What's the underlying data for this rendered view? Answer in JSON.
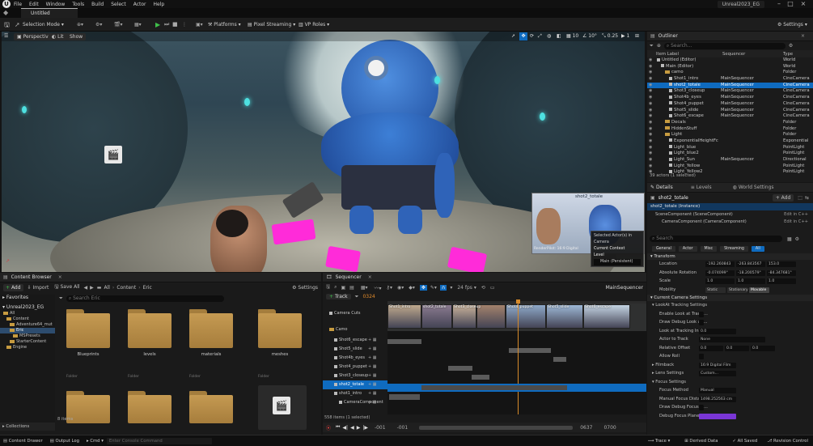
{
  "menubar": {
    "items": [
      "File",
      "Edit",
      "Window",
      "Tools",
      "Build",
      "Select",
      "Actor",
      "Help"
    ],
    "project": "Unreal2023_EG"
  },
  "tab": {
    "title": "Untitled"
  },
  "toolbar": {
    "mode": "Selection Mode",
    "platforms": "Platforms",
    "pixel_streaming": "Pixel Streaming",
    "vp_roles": "VP Roles",
    "settings": "Settings"
  },
  "viewport": {
    "perspective": "Perspective",
    "lit": "Lit",
    "show": "Show",
    "grid_snap": "10",
    "rot_snap": "10°",
    "scale_snap": "0.25",
    "cam_speed": "1",
    "pip_title": "shot2_totale",
    "pip_sub": "RenderPilot: 16:9 Digital",
    "ctx_selected": "Selected Actor(s) in",
    "ctx_camera": "Camera",
    "ctx_current": "Current Context",
    "ctx_level": "Level",
    "ctx_main": "Main (Persistent)"
  },
  "outliner": {
    "title": "Outliner",
    "search": "Search...",
    "col_label": "Item Label",
    "col_seq": "Sequencer",
    "col_type": "Type",
    "status": "39 actors (1 selected)",
    "rows": [
      {
        "label": "Untitled (Editor)",
        "seq": "",
        "type": "World",
        "indent": 0,
        "kind": "world"
      },
      {
        "label": "Main (Editor)",
        "seq": "",
        "type": "World",
        "indent": 1,
        "kind": "world"
      },
      {
        "label": "camo",
        "seq": "",
        "type": "Folder",
        "indent": 2,
        "kind": "folder"
      },
      {
        "label": "Shot1_intro",
        "seq": "MainSequencer",
        "type": "CineCamera",
        "indent": 3,
        "kind": "actor"
      },
      {
        "label": "shot2_totale",
        "seq": "MainSequencer",
        "type": "CineCamera",
        "indent": 3,
        "kind": "actor",
        "sel": true
      },
      {
        "label": "Shot3_closeup",
        "seq": "MainSequencer",
        "type": "CineCamera",
        "indent": 3,
        "kind": "actor"
      },
      {
        "label": "Shot4b_eyes",
        "seq": "MainSequencer",
        "type": "CineCamera",
        "indent": 3,
        "kind": "actor"
      },
      {
        "label": "Shot4_puppet",
        "seq": "MainSequencer",
        "type": "CineCamera",
        "indent": 3,
        "kind": "actor"
      },
      {
        "label": "Shot5_slide",
        "seq": "MainSequencer",
        "type": "CineCamera",
        "indent": 3,
        "kind": "actor"
      },
      {
        "label": "Shot6_escape",
        "seq": "MainSequencer",
        "type": "CineCamera",
        "indent": 3,
        "kind": "actor"
      },
      {
        "label": "Decals",
        "seq": "",
        "type": "Folder",
        "indent": 2,
        "kind": "folder"
      },
      {
        "label": "HiddenStuff",
        "seq": "",
        "type": "Folder",
        "indent": 2,
        "kind": "folder"
      },
      {
        "label": "Light",
        "seq": "",
        "type": "Folder",
        "indent": 2,
        "kind": "folder"
      },
      {
        "label": "ExponentialHeightFc",
        "seq": "",
        "type": "Exponential",
        "indent": 3,
        "kind": "actor"
      },
      {
        "label": "Light_blue",
        "seq": "",
        "type": "PointLight",
        "indent": 3,
        "kind": "actor"
      },
      {
        "label": "Light_blue2",
        "seq": "",
        "type": "PointLight",
        "indent": 3,
        "kind": "actor"
      },
      {
        "label": "Light_Sun",
        "seq": "MainSequencer",
        "type": "Directional",
        "indent": 3,
        "kind": "actor"
      },
      {
        "label": "Light_Yellow",
        "seq": "",
        "type": "PointLight",
        "indent": 3,
        "kind": "actor"
      },
      {
        "label": "Light_Yellow2",
        "seq": "",
        "type": "PointLight",
        "indent": 3,
        "kind": "actor"
      }
    ]
  },
  "details": {
    "tab_details": "Details",
    "tab_levels": "Levels",
    "tab_world": "World Settings",
    "actor": "shot2_totale",
    "add": "+ Add",
    "instance": "shot2_totale (Instance)",
    "comp1": "SceneComponent (SceneComponent)",
    "comp2": "CameraComponent (CameraComponent)",
    "edit_cpp": "Edit in C++",
    "search": "Search",
    "filters": [
      "General",
      "Actor",
      "Misc",
      "Streaming",
      "All"
    ],
    "transform": "Transform",
    "location": "Location",
    "abs_rotation": "Absolute Rotation",
    "scale": "Scale",
    "mobility": "Mobility",
    "loc": [
      "-192.260843",
      "-263.843567",
      "153.0"
    ],
    "rot": [
      "-0.074099°",
      "-18.200579°",
      "-84.347681°"
    ],
    "scl": [
      "1.0",
      "1.0",
      "1.0"
    ],
    "mobility_opts": [
      "Static",
      "Stationary",
      "Movable"
    ],
    "cam_settings": "Current Camera Settings",
    "lookat": "LookAt Tracking Settings",
    "enable_lookat": "Enable Look at Tracki...",
    "draw_debug": "Draw Debug Look at ...",
    "lookat_offset": "Look at Tracking Inter...",
    "lookat_val": "0.0",
    "actor_track": "Actor to Track",
    "none": "None",
    "rel_offset": "Relative Offset",
    "ro": [
      "0.0",
      "0.0",
      "0.0"
    ],
    "allow_roll": "Allow Roll",
    "filmback": "Filmback",
    "filmback_val": "16:9 Digital Film",
    "lens": "Lens Settings",
    "lens_val": "Custom...",
    "focus": "Focus Settings",
    "focus_method": "Focus Method",
    "focus_method_val": "Manual",
    "manual_focus": "Manual Focus Distance",
    "manual_focus_val": "1498.252563 cm",
    "draw_focus": "Draw Debug Focus Pl...",
    "debug_color": "Debug Focus Plane C..."
  },
  "content": {
    "title": "Content Browser",
    "add": "Add",
    "import": "Import",
    "save_all": "Save All",
    "breadcrumb": [
      "All",
      "Content",
      "Eric"
    ],
    "settings": "Settings",
    "favorites": "Favorites",
    "project": "Unreal2023_EG",
    "search_eric": "Search Eric",
    "tree": [
      "All",
      "Content",
      "Adventure64_mut",
      "Eric",
      "MSPresets",
      "StarterContent",
      "Engine"
    ],
    "folders": [
      "Blueprints",
      "levels",
      "materials",
      "meshes"
    ],
    "folder_sub": "Folder",
    "count": "8 items",
    "collections": "Collections"
  },
  "sequencer": {
    "title": "Sequencer",
    "fps": "24 fps",
    "name": "MainSequencer",
    "track": "Track",
    "time": "0324",
    "tracks": [
      "Camera Cuts",
      "Camo",
      "Shot6_escape",
      "Shot5_slide",
      "Shot4b_eyes",
      "Shot4_puppet",
      "Shot3_closeup",
      "shot2_totale",
      "shot1_intro",
      "CameraComponent"
    ],
    "clips": [
      "Shot1_intro",
      "shot2_totale",
      "Shot3_closeup",
      "Shot4_puppet",
      "Shot5_slide",
      "Shot6_escape"
    ],
    "status": "558 items (1 selected)",
    "start": "-001",
    "start2": "-001",
    "end": "0637",
    "end2": "0700"
  },
  "status": {
    "content_drawer": "Content Drawer",
    "output_log": "Output Log",
    "cmd": "Cmd",
    "console": "Enter Console Command",
    "trace": "Trace",
    "derived": "Derived Data",
    "saved": "All Saved",
    "revision": "Revision Control"
  },
  "colors": {
    "accent": "#0f6bbf",
    "folder": "#c59a52",
    "magenta": "#ff2bd9"
  }
}
